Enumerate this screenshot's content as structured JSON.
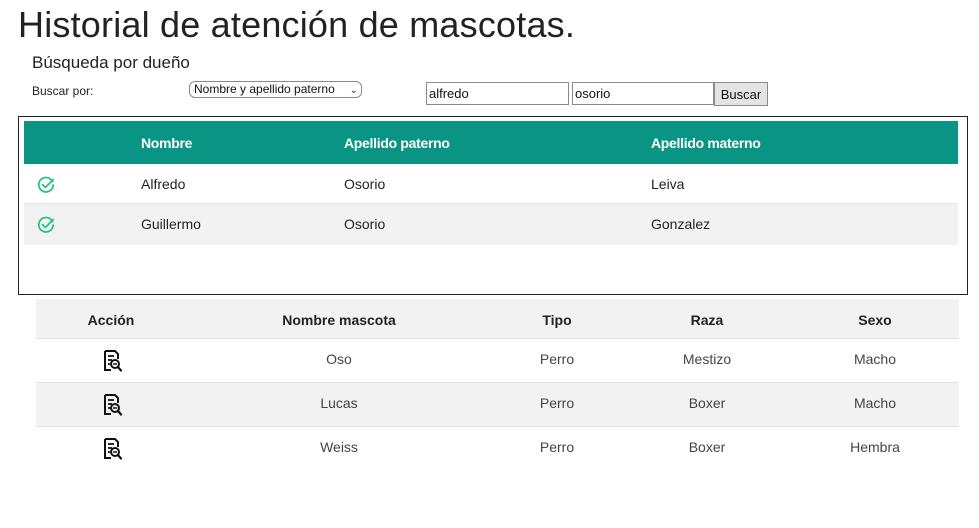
{
  "page": {
    "title": "Historial de atención de mascotas."
  },
  "search": {
    "subtitle": "Búsqueda por dueño",
    "label": "Buscar por:",
    "select_value": "Nombre y apellido paterno",
    "name_value": "alfredo",
    "lastname_value": "osorio",
    "button_label": "Buscar"
  },
  "owners": {
    "header_color": "#099484",
    "columns": [
      "Nombre",
      "Apellido paterno",
      "Apellido materno"
    ],
    "rows": [
      {
        "icon": "check-circle-icon",
        "nombre": "Alfredo",
        "paterno": "Osorio",
        "materno": "Leiva"
      },
      {
        "icon": "check-circle-icon",
        "nombre": "Guillermo",
        "paterno": "Osorio",
        "materno": "Gonzalez"
      }
    ]
  },
  "pets": {
    "columns": [
      "Acción",
      "Nombre mascota",
      "Tipo",
      "Raza",
      "Sexo"
    ],
    "rows": [
      {
        "icon": "document-search-icon",
        "nombre": "Oso",
        "tipo": "Perro",
        "raza": "Mestizo",
        "sexo": "Macho"
      },
      {
        "icon": "document-search-icon",
        "nombre": "Lucas",
        "tipo": "Perro",
        "raza": "Boxer",
        "sexo": "Macho"
      },
      {
        "icon": "document-search-icon",
        "nombre": "Weiss",
        "tipo": "Perro",
        "raza": "Boxer",
        "sexo": "Hembra"
      }
    ]
  }
}
